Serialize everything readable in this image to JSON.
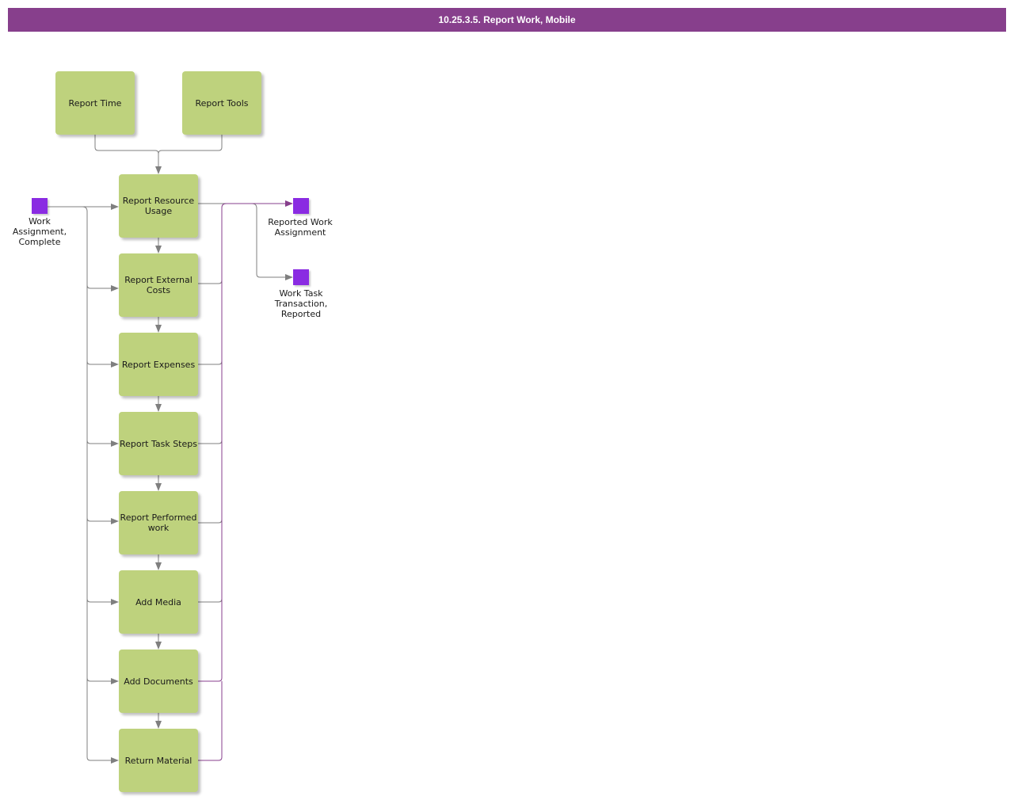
{
  "title": "10.25.3.5. Report Work, Mobile",
  "colors": {
    "title_bar": "#873f8c",
    "activity": "#bed27d",
    "event": "#8a2be2",
    "flow_gray": "#7f7f7f",
    "flow_purple": "#873f8c"
  },
  "activities": {
    "report_time": "Report Time",
    "report_tools": "Report Tools",
    "report_resource_usage": "Report Resource Usage",
    "report_external_costs": "Report External Costs",
    "report_expenses": "Report Expenses",
    "report_task_steps": "Report Task Steps",
    "report_performed_work": "Report Performed work",
    "add_media": "Add Media",
    "add_documents": "Add Documents",
    "return_material": "Return Material"
  },
  "events": {
    "start": "Work Assignment, Complete",
    "end_reported_work_assignment": "Reported Work Assignment",
    "end_work_task_transaction": "Work Task Transaction, Reported"
  }
}
